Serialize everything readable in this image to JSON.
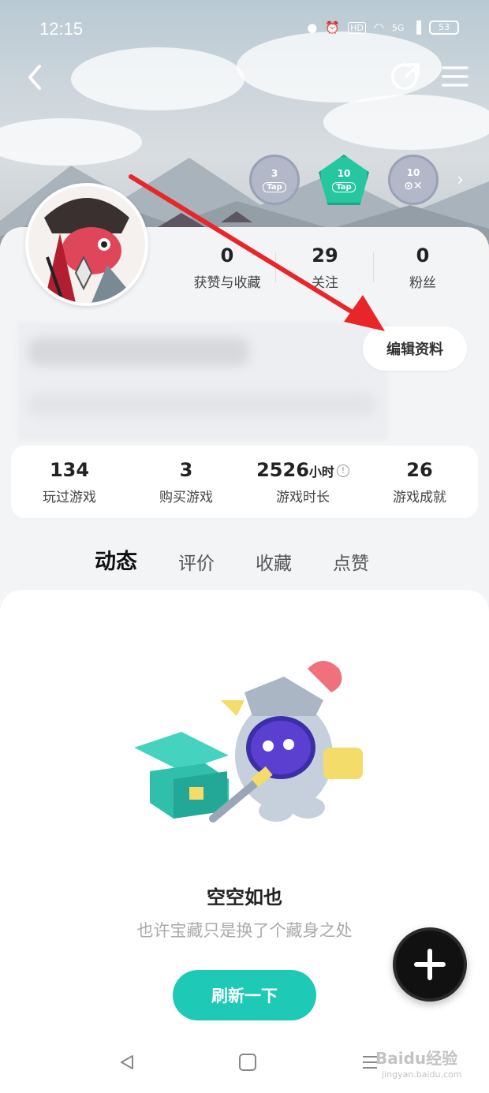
{
  "status_bar": {
    "time": "12:15",
    "network": "5G",
    "hd": "HD",
    "battery": "53"
  },
  "badges": [
    {
      "level": "3",
      "tag": "Tap"
    },
    {
      "level": "10",
      "tag": "Tap"
    },
    {
      "level": "10",
      "tag": ""
    }
  ],
  "profile_stats": [
    {
      "value": "0",
      "label": "获赞与收藏"
    },
    {
      "value": "29",
      "label": "关注"
    },
    {
      "value": "0",
      "label": "粉丝"
    }
  ],
  "edit_button": "编辑资料",
  "game_stats": [
    {
      "value": "134",
      "unit": "",
      "label": "玩过游戏"
    },
    {
      "value": "3",
      "unit": "",
      "label": "购买游戏"
    },
    {
      "value": "2526",
      "unit": "小时",
      "label": "游戏时长"
    },
    {
      "value": "26",
      "unit": "",
      "label": "游戏成就"
    }
  ],
  "tabs": [
    {
      "label": "动态",
      "active": true
    },
    {
      "label": "评价",
      "active": false
    },
    {
      "label": "收藏",
      "active": false
    },
    {
      "label": "点赞",
      "active": false
    }
  ],
  "empty_state": {
    "title": "空空如也",
    "subtitle": "也许宝藏只是换了个藏身之处",
    "button": "刷新一下"
  },
  "watermark": {
    "brand": "Baidu经验",
    "url": "jingyan.baidu.com"
  },
  "colors": {
    "accent": "#1ec9b6",
    "arrow": "#e8262a"
  }
}
